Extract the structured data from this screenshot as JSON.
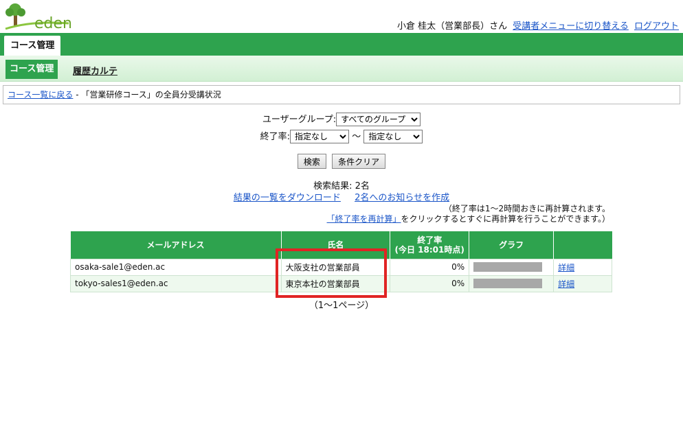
{
  "brand": {
    "logo_text": "eden"
  },
  "header": {
    "user": "小倉 桂太（営業部長）さん",
    "switch_link": "受講者メニューに切り替える",
    "logout_link": "ログアウト"
  },
  "tabs": {
    "active": "コース管理"
  },
  "subnav": {
    "active": "コース管理",
    "link": "履歴カルテ"
  },
  "breadcrumb": {
    "back": "コース一覧に戻る",
    "current": " - 「営業研修コース」の全員分受講状況"
  },
  "filters": {
    "group_label": "ユーザーグループ:",
    "group_value": "すべてのグループ",
    "rate_label": "終了率:",
    "rate_from": "指定なし",
    "tilde": "〜",
    "rate_to": "指定なし"
  },
  "buttons": {
    "search": "検索",
    "clear": "条件クリア"
  },
  "result": {
    "count": "検索結果: 2名",
    "download": "結果の一覧をダウンロード",
    "notify": "2名へのお知らせを作成"
  },
  "note": {
    "line1": "（終了率は1〜2時間おきに再計算されます。",
    "recalc_link": "「終了率を再計算」",
    "line2_rest": "をクリックするとすぐに再計算を行うことができます。）"
  },
  "table": {
    "headers": {
      "email": "メールアドレス",
      "name": "氏名",
      "rate_line1": "終了率",
      "rate_line2": "(今日 18:01時点)",
      "graph": "グラフ"
    },
    "rows": [
      {
        "email": "osaka-sale1@eden.ac",
        "name": "大阪支社の営業部員",
        "rate": "0%",
        "progress": 0,
        "detail": "詳細"
      },
      {
        "email": "tokyo-sales1@eden.ac",
        "name": "東京本社の営業部員",
        "rate": "0%",
        "progress": 0,
        "detail": "詳細"
      }
    ]
  },
  "pager": "（1〜1ページ）",
  "colors": {
    "primary_green": "#2ea34e",
    "highlight_red": "#e02424",
    "link_blue": "#1a55c8"
  }
}
